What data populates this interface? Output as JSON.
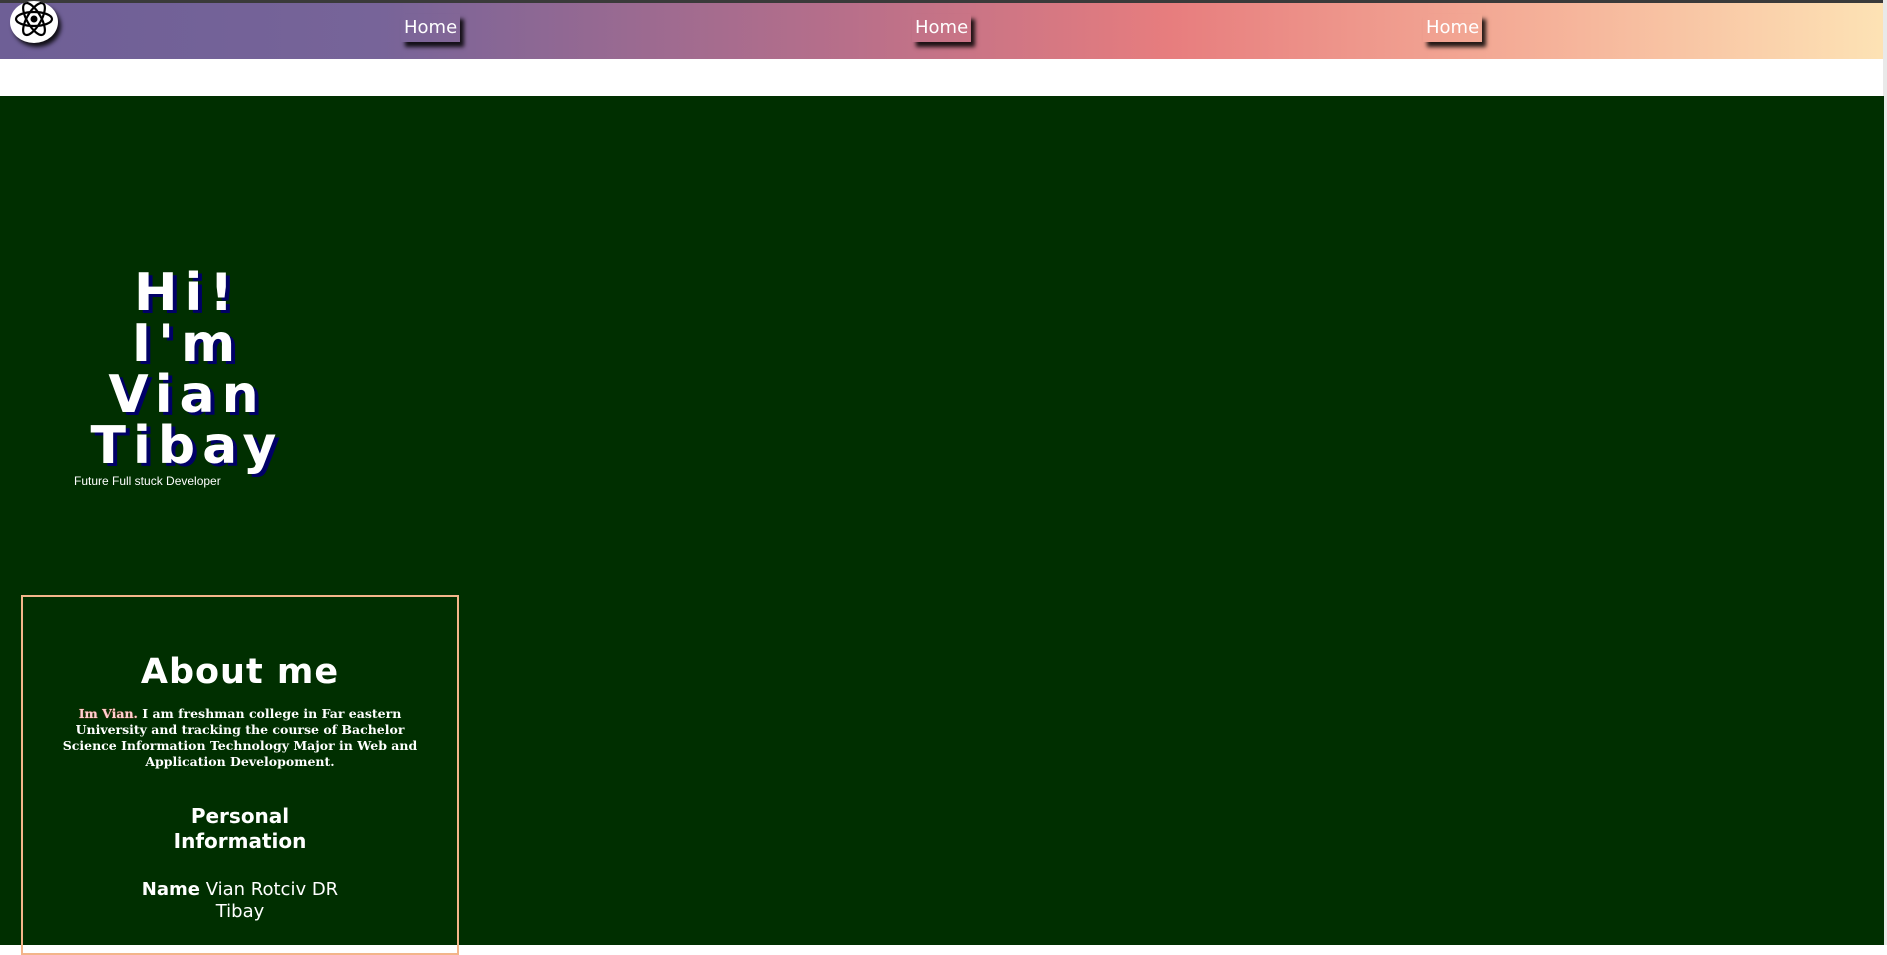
{
  "navbar": {
    "links": [
      "Home",
      "Home",
      "Home"
    ]
  },
  "hero": {
    "lines": [
      "Hi!",
      "I'm",
      "Vian",
      "Tibay"
    ],
    "tagline": "Future Full stuck Developer"
  },
  "about": {
    "title": "About me",
    "intro_highlight": "Im Vian.",
    "intro_text": " I am freshman college in Far eastern University and tracking the course of Bachelor Science Information Technology Major in Web and Application Developoment.",
    "personal_title": "Personal Information",
    "name_label": "Name",
    "name_value": "Vian Rotciv DR Tibay"
  },
  "icons": {
    "logo": "atom-icon"
  }
}
